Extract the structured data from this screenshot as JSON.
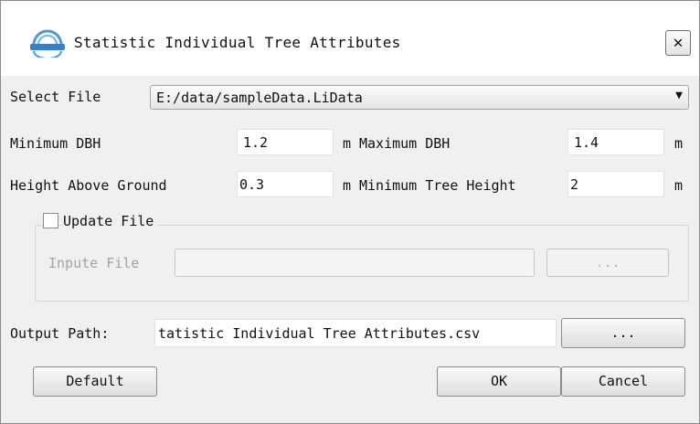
{
  "window": {
    "title": "Statistic Individual Tree Attributes",
    "close_glyph": "✕",
    "logo_icon": "lidar360-logo"
  },
  "select_file": {
    "label": "Select File",
    "value": "E:/data/sampleData.LiData",
    "arrow": "▼"
  },
  "params": {
    "min_dbh_label": "Minimum DBH",
    "min_dbh_value": "1.2",
    "min_dbh_unit": "m",
    "max_dbh_label": "Maximum DBH",
    "max_dbh_value": "1.4",
    "max_dbh_unit": "m",
    "height_above_ground_label": "Height Above Ground",
    "height_above_ground_value": "0.3",
    "height_above_ground_unit": "m",
    "min_tree_height_label": "Minimum Tree Height",
    "min_tree_height_value": "2",
    "min_tree_height_unit": "m"
  },
  "update_file": {
    "label": "Update File",
    "checked": false,
    "input_label": "Inpute File",
    "input_value": "",
    "browse_label": "..."
  },
  "output": {
    "label": "Output Path:",
    "value": "tatistic Individual Tree Attributes.csv",
    "browse_label": "..."
  },
  "buttons": {
    "default": "Default",
    "ok": "OK",
    "cancel": "Cancel"
  }
}
